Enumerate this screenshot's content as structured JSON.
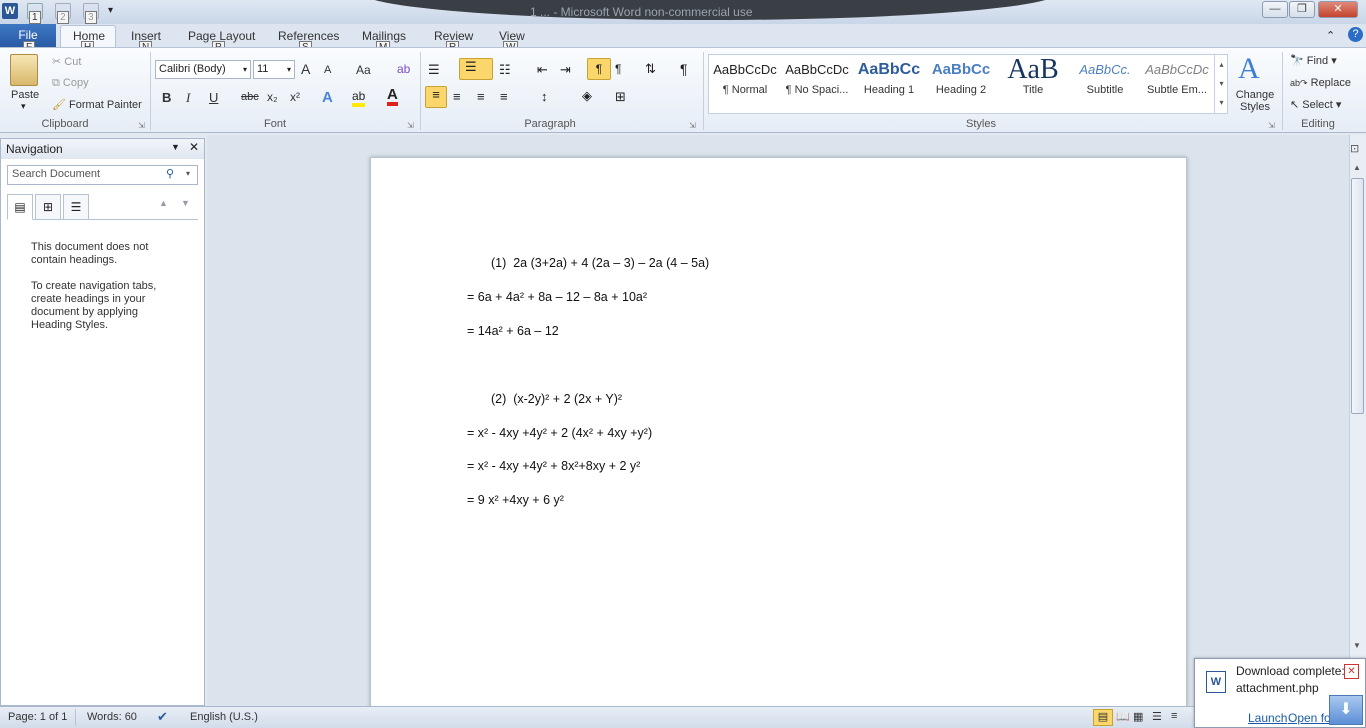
{
  "window": {
    "title": "1 ... - Microsoft Word non-commercial use",
    "qat_keytips": [
      "1",
      "2",
      "3"
    ],
    "min": "—",
    "max": "❐",
    "close": "✕"
  },
  "tabs": [
    {
      "label": "File",
      "keytip": "F"
    },
    {
      "label": "Home",
      "keytip": "H"
    },
    {
      "label": "Insert",
      "keytip": "N"
    },
    {
      "label": "Page Layout",
      "keytip": "P"
    },
    {
      "label": "References",
      "keytip": "S"
    },
    {
      "label": "Mailings",
      "keytip": "M"
    },
    {
      "label": "Review",
      "keytip": "R"
    },
    {
      "label": "View",
      "keytip": "W"
    }
  ],
  "clipboard": {
    "paste": "Paste",
    "cut": "Cut",
    "copy": "Copy",
    "format_painter": "Format Painter",
    "group": "Clipboard"
  },
  "font": {
    "font_name": "Calibri (Body)",
    "font_size": "11",
    "group": "Font",
    "grow": "A",
    "shrink": "A",
    "change_case": "Aa",
    "bold": "B",
    "italic": "I",
    "underline": "U",
    "strike": "abc",
    "subscript": "x₂",
    "superscript": "x²",
    "font_color_letter": "A"
  },
  "paragraph": {
    "group": "Paragraph",
    "pilcrow": "¶"
  },
  "styles": {
    "group": "Styles",
    "items": [
      {
        "sample": "AaBbCcDc",
        "name": "¶ Normal"
      },
      {
        "sample": "AaBbCcDc",
        "name": "¶ No Spaci..."
      },
      {
        "sample": "AaBbCc",
        "name": "Heading 1"
      },
      {
        "sample": "AaBbCc",
        "name": "Heading 2"
      },
      {
        "sample": "AaB",
        "name": "Title"
      },
      {
        "sample": "AaBbCc.",
        "name": "Subtitle"
      },
      {
        "sample": "AaBbCcDc",
        "name": "Subtle Em..."
      }
    ],
    "change_styles": "Change Styles"
  },
  "editing": {
    "group": "Editing",
    "find": "Find",
    "replace": "Replace",
    "select": "Select"
  },
  "navigation": {
    "title": "Navigation",
    "search_placeholder": "Search Document",
    "msg1": "This document does not contain headings.",
    "msg2": "To create navigation tabs, create headings in your document by applying Heading Styles."
  },
  "document": {
    "lines": [
      "(1)  2a (3+2a) + 4 (2a – 3) – 2a (4 – 5a)",
      "= 6a + 4a² + 8a – 12 – 8a + 10a²",
      "= 14a² + 6a – 12",
      "(2)  (x-2y)² + 2 (2x + Y)²",
      "= x² - 4xy +4y² + 2 (4x² + 4xy +y²)",
      "= x² - 4xy +4y² + 8x²+8xy + 2 y²",
      "= 9 x² +4xy + 6 y²"
    ]
  },
  "status": {
    "page": "Page: 1 of 1",
    "words": "Words: 60",
    "language": "English (U.S.)"
  },
  "download": {
    "title": "Download complete:",
    "file": "attachment.php",
    "launch": "Launch",
    "open_folder": "Open folder"
  }
}
